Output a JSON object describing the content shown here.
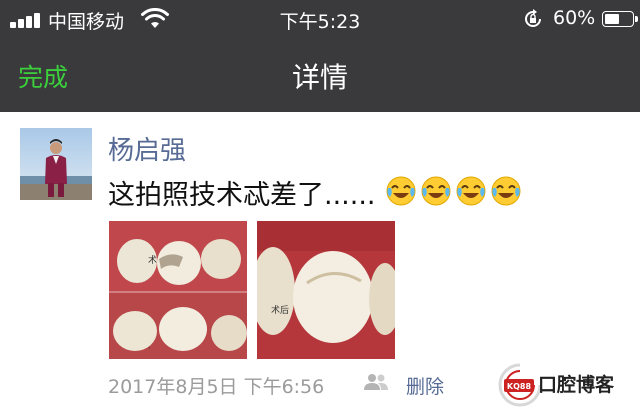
{
  "status_bar": {
    "carrier": "中国移动",
    "time": "下午5:23",
    "battery_percent": "60%",
    "battery_level": 0.6,
    "icons": [
      "signal-icon",
      "wifi-icon",
      "rotation-lock-icon",
      "battery-icon"
    ]
  },
  "nav": {
    "done_label": "完成",
    "title": "详情",
    "done_color": "#3ccf3c",
    "background": "#3a3a3c"
  },
  "post": {
    "username": "杨启强",
    "text": "这拍照技术忒差了......",
    "emojis": [
      "crying-laughing-emoji",
      "crying-laughing-emoji",
      "crying-laughing-emoji",
      "crying-laughing-emoji"
    ],
    "photos": [
      {
        "name": "teeth-photo-1",
        "overlay_text": "术"
      },
      {
        "name": "teeth-photo-2",
        "overlay_text": "术后"
      }
    ],
    "timestamp": "2017年8月5日 下午6:56",
    "privacy_icon": "friends-icon",
    "delete_label": "删除",
    "link_color": "#576b95"
  },
  "watermark": {
    "badge": "KQ88",
    "text": "口腔博客"
  }
}
